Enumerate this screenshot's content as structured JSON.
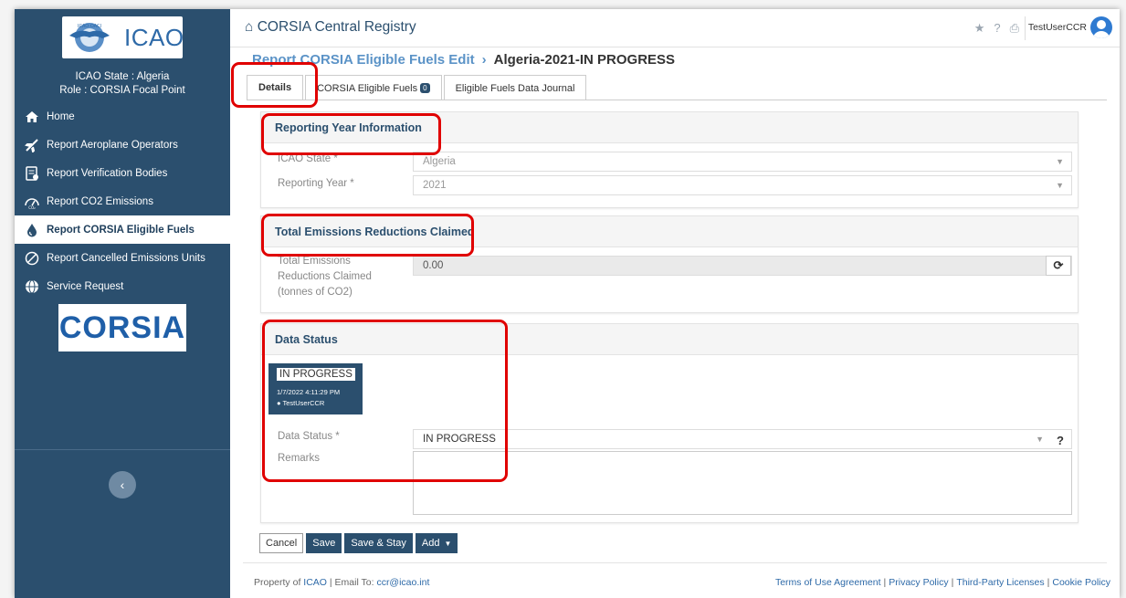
{
  "app": {
    "title": "CORSIA Central Registry"
  },
  "logo": {
    "text": "ICAO"
  },
  "sidebar": {
    "state": "ICAO State : Algeria",
    "role": "Role : CORSIA Focal Point",
    "items": [
      {
        "label": "Home",
        "icon": "home-icon"
      },
      {
        "label": "Report Aeroplane Operators",
        "icon": "airplane-icon"
      },
      {
        "label": "Report Verification Bodies",
        "icon": "document-badge-icon"
      },
      {
        "label": "Report CO2 Emissions",
        "icon": "co2-gauge-icon"
      },
      {
        "label": "Report CORSIA Eligible Fuels",
        "icon": "fuel-drop-icon",
        "active": true
      },
      {
        "label": "Report Cancelled Emissions Units",
        "icon": "cancelled-units-icon"
      },
      {
        "label": "Service Request",
        "icon": "globe-service-icon"
      }
    ],
    "corsia_logo_text": "CORSIA"
  },
  "header": {
    "user": "TestUserCCR"
  },
  "breadcrumb": {
    "parent": "Report CORSIA Eligible Fuels Edit",
    "separator": "›",
    "current": "Algeria-2021-IN PROGRESS"
  },
  "tabs": [
    {
      "label": "Details",
      "active": true
    },
    {
      "label": "CORSIA Eligible Fuels",
      "badge": "0"
    },
    {
      "label": "Eligible Fuels Data Journal"
    }
  ],
  "reporting_year": {
    "heading": "Reporting Year Information",
    "state_label": "ICAO State *",
    "state_value": "Algeria",
    "year_label": "Reporting Year *",
    "year_value": "2021"
  },
  "emissions": {
    "heading": "Total Emissions Reductions Claimed",
    "label_1": "Total Emissions",
    "label_2": "Reductions Claimed",
    "label_3": "(tonnes of CO2)",
    "value": "0.00"
  },
  "data_status": {
    "heading": "Data Status",
    "card_status": "IN PROGRESS",
    "card_time": "1/7/2022 4:11:29 PM",
    "card_user": "TestUserCCR",
    "status_label": "Data Status *",
    "status_value": "IN PROGRESS",
    "remarks_label": "Remarks",
    "help": "?"
  },
  "actions": {
    "cancel": "Cancel",
    "save": "Save",
    "save_stay": "Save & Stay",
    "add": "Add"
  },
  "footer": {
    "property": "Property of",
    "icao_link": "ICAO",
    "email_text": "| Email To:",
    "email": "ccr@icao.int",
    "links": [
      "Terms of Use Agreement",
      "Privacy Policy",
      "Third-Party Licenses",
      "Cookie Policy"
    ]
  },
  "colors": {
    "sidebar": "#2b4f6e",
    "accent": "#2e6aa8",
    "annotation": "#e00000"
  }
}
